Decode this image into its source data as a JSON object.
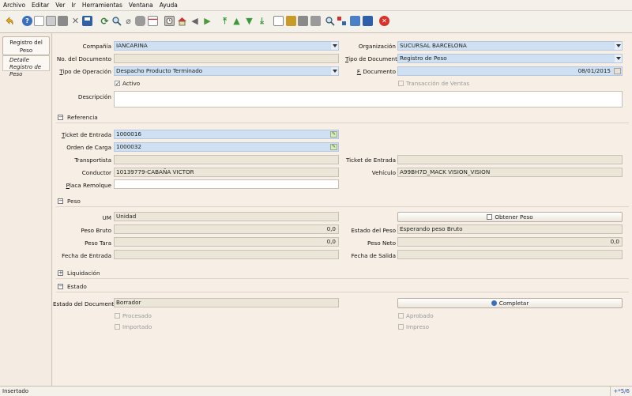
{
  "menu": [
    "Archivo",
    "Editar",
    "Ver",
    "Ir",
    "Herramientas",
    "Ventana",
    "Ayuda"
  ],
  "toolbar": [
    "undo-icon",
    "help-icon",
    "new-icon",
    "copy-icon",
    "delete-icon",
    "delete-selection-icon",
    "save-icon",
    "refresh-icon",
    "find-icon",
    "attachment-icon",
    "chat-icon",
    "grid-toggle-icon",
    "history-icon",
    "home-icon",
    "parent-record-icon",
    "detail-record-icon",
    "first-record-icon",
    "previous-record-icon",
    "next-record-icon",
    "last-record-icon",
    "report-icon",
    "archive-icon",
    "print-preview-icon",
    "print-icon",
    "zoom-across-icon",
    "workflow-icon",
    "product-info-icon",
    "workbench-icon",
    "exit-icon"
  ],
  "sidebar": {
    "tab": "Registro del Peso",
    "sub1": "Detalle",
    "sub2": "Registro de Peso"
  },
  "header": {
    "compania_label": "Compañía",
    "compania": "IANCARINA",
    "organizacion_label": "Organización",
    "organizacion": "SUCURSAL BARCELONA",
    "nodoc_label": "No. del Documento",
    "nodoc": "",
    "tipodoc_label": "Tipo de Documento",
    "tipodoc": "Registro de Peso",
    "tipoop_label": "Tipo de Operación",
    "tipoop": "Despacho Producto Terminado",
    "fdoc_label": "F. Documento",
    "fdoc": "08/01/2015",
    "activo_label": "Activo",
    "transaccion_label": "Transacción de Ventas",
    "descripcion_label": "Descripción",
    "descripcion": ""
  },
  "referencia": {
    "title": "Referencia",
    "ticket_label": "Ticket de Entrada",
    "ticket": "1000016",
    "ticket2_label": "Ticket de Entrada",
    "ticket2": "",
    "orden_label": "Orden de Carga",
    "orden": "1000032",
    "transportista_label": "Transportista",
    "transportista": "",
    "conductor_label": "Conductor",
    "conductor": "10139779-CABAÑA VICTOR",
    "vehiculo_label": "Vehículo",
    "vehiculo": "A99BH7D_MACK VISION_VISION",
    "placa_label": "Placa Remolque",
    "placa": ""
  },
  "peso": {
    "title": "Peso",
    "um_label": "UM",
    "um": "Unidad",
    "obtener_button": "Obtener Peso",
    "bruto_label": "Peso Bruto",
    "bruto": "0,0",
    "estado_label": "Estado del Peso",
    "estado": "Esperando peso Bruto",
    "tara_label": "Peso Tara",
    "tara": "0,0",
    "neto_label": "Peso Neto",
    "neto": "0,0",
    "fentrada_label": "Fecha de Entrada",
    "fentrada": "",
    "fsalida_label": "Fecha de Salida",
    "fsalida": ""
  },
  "liquidacion": {
    "title": "Liquidación"
  },
  "estado": {
    "title": "Estado",
    "docstatus_label": "Estado del Documento",
    "docstatus": "Borrador",
    "completar_button": "Completar",
    "procesado_label": "Procesado",
    "aprobado_label": "Aprobado",
    "importado_label": "Importado",
    "impreso_label": "Impreso"
  },
  "status": {
    "text": "Insertado",
    "record": "+*5/6"
  }
}
